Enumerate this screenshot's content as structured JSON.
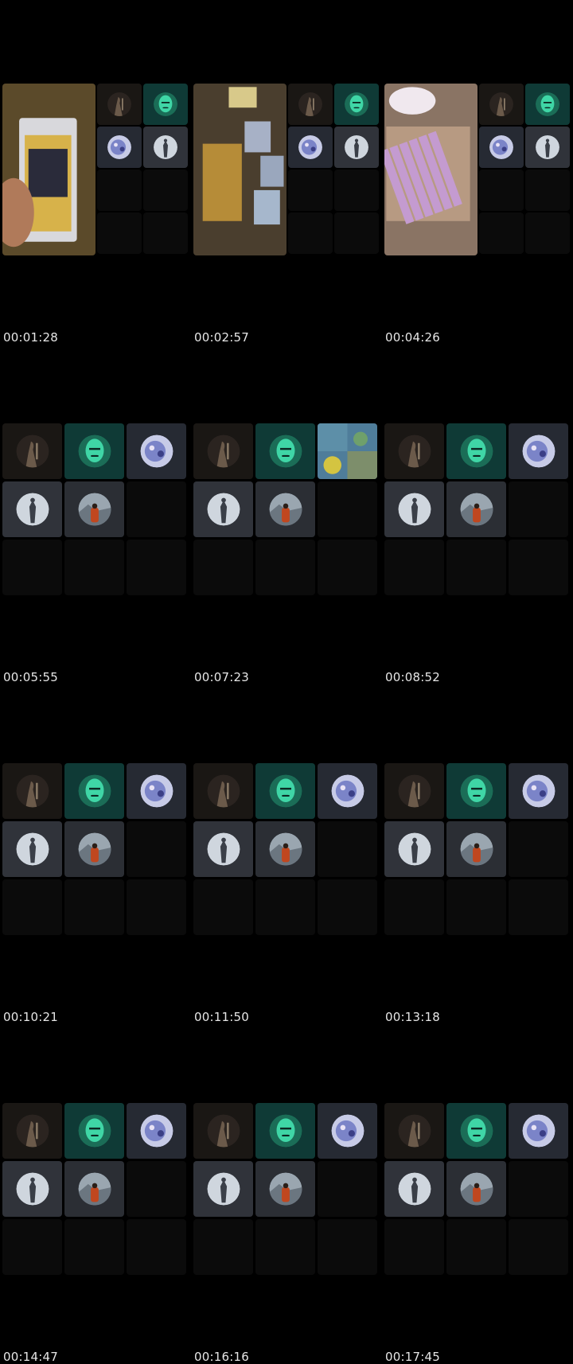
{
  "timestamps": [
    "00:01:28",
    "00:02:57",
    "00:04:26",
    "00:05:55",
    "00:07:23",
    "00:08:52",
    "00:10:21",
    "00:11:50",
    "00:13:18",
    "00:14:47",
    "00:16:16",
    "00:17:45"
  ],
  "avatars": [
    {
      "name": "person-silhouette-avatar",
      "bg": "#1a1714",
      "colors": [
        "#6b5a4a",
        "#2b2420"
      ]
    },
    {
      "name": "green-mask-avatar",
      "bg": "#0f3a36",
      "colors": [
        "#3fd6a6",
        "#1b6d57"
      ]
    },
    {
      "name": "blue-creature-avatar",
      "bg": "#262a33",
      "colors": [
        "#7b84c8",
        "#c7cbe7"
      ]
    },
    {
      "name": "figure-wings-avatar",
      "bg": "#30333a",
      "colors": [
        "#cfd6de",
        "#3a3f48"
      ]
    },
    {
      "name": "mountain-person-avatar",
      "bg": "#2b2e34",
      "colors": [
        "#9aa6b0",
        "#c0471f"
      ]
    }
  ],
  "media": [
    {
      "name": "card-in-slab-video",
      "colors": [
        "#5b4a2a",
        "#d7b24a",
        "#2a2b3a"
      ]
    },
    {
      "name": "cards-on-table-video",
      "colors": [
        "#4a3e2e",
        "#a7b1c6",
        "#c99a3a"
      ]
    },
    {
      "name": "box-of-packs-video",
      "colors": [
        "#8a7464",
        "#c49bd0",
        "#f0e8ee"
      ]
    },
    {
      "name": "cards-screenshare-tile",
      "colors": [
        "#4f7d9a",
        "#d4c441",
        "#6fa06b"
      ]
    }
  ]
}
